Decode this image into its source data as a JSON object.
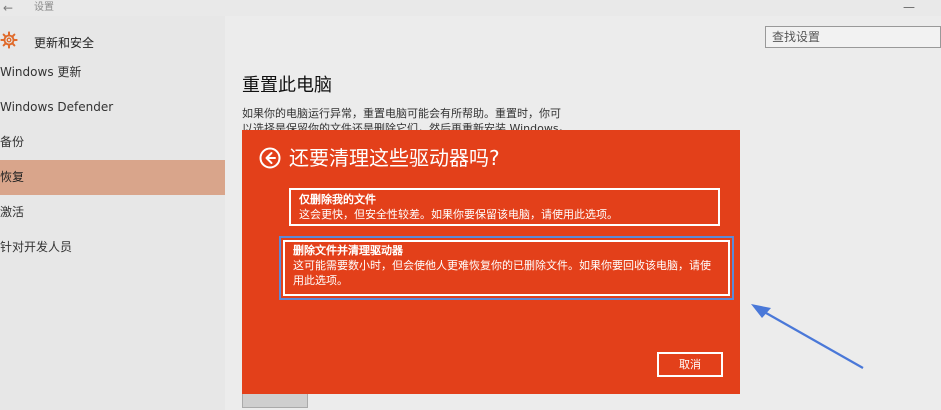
{
  "window": {
    "title": "设置"
  },
  "sidebar": {
    "header": "更新和安全",
    "items": [
      {
        "label": "Windows 更新",
        "active": false
      },
      {
        "label": "Windows Defender",
        "active": false
      },
      {
        "label": "备份",
        "active": false
      },
      {
        "label": "恢复",
        "active": true
      },
      {
        "label": "激活",
        "active": false
      },
      {
        "label": "针对开发人员",
        "active": false
      }
    ]
  },
  "search": {
    "placeholder": "查找设置"
  },
  "main": {
    "heading": "重置此电脑",
    "desc_line1": "如果你的电脑运行异常，重置电脑可能会有所帮助。重置时，你可",
    "desc_line2": "以选择是保留你的文件还是删除它们，然后再重新安装 Windows。"
  },
  "dialog": {
    "title": "还要清理这些驱动器吗?",
    "option1": {
      "title": "仅删除我的文件",
      "desc": "这会更快，但安全性较差。如果你要保留该电脑，请使用此选项。"
    },
    "option2": {
      "title": "删除文件并清理驱动器",
      "desc": "这可能需要数小时，但会使他人更难恢复你的已删除文件。如果你要回收该电脑，请使用此选项。"
    },
    "cancel_label": "取消"
  },
  "colors": {
    "dialog_bg": "#e3401a",
    "active_item": "#d9a58b",
    "highlight": "#5b8ad8"
  }
}
